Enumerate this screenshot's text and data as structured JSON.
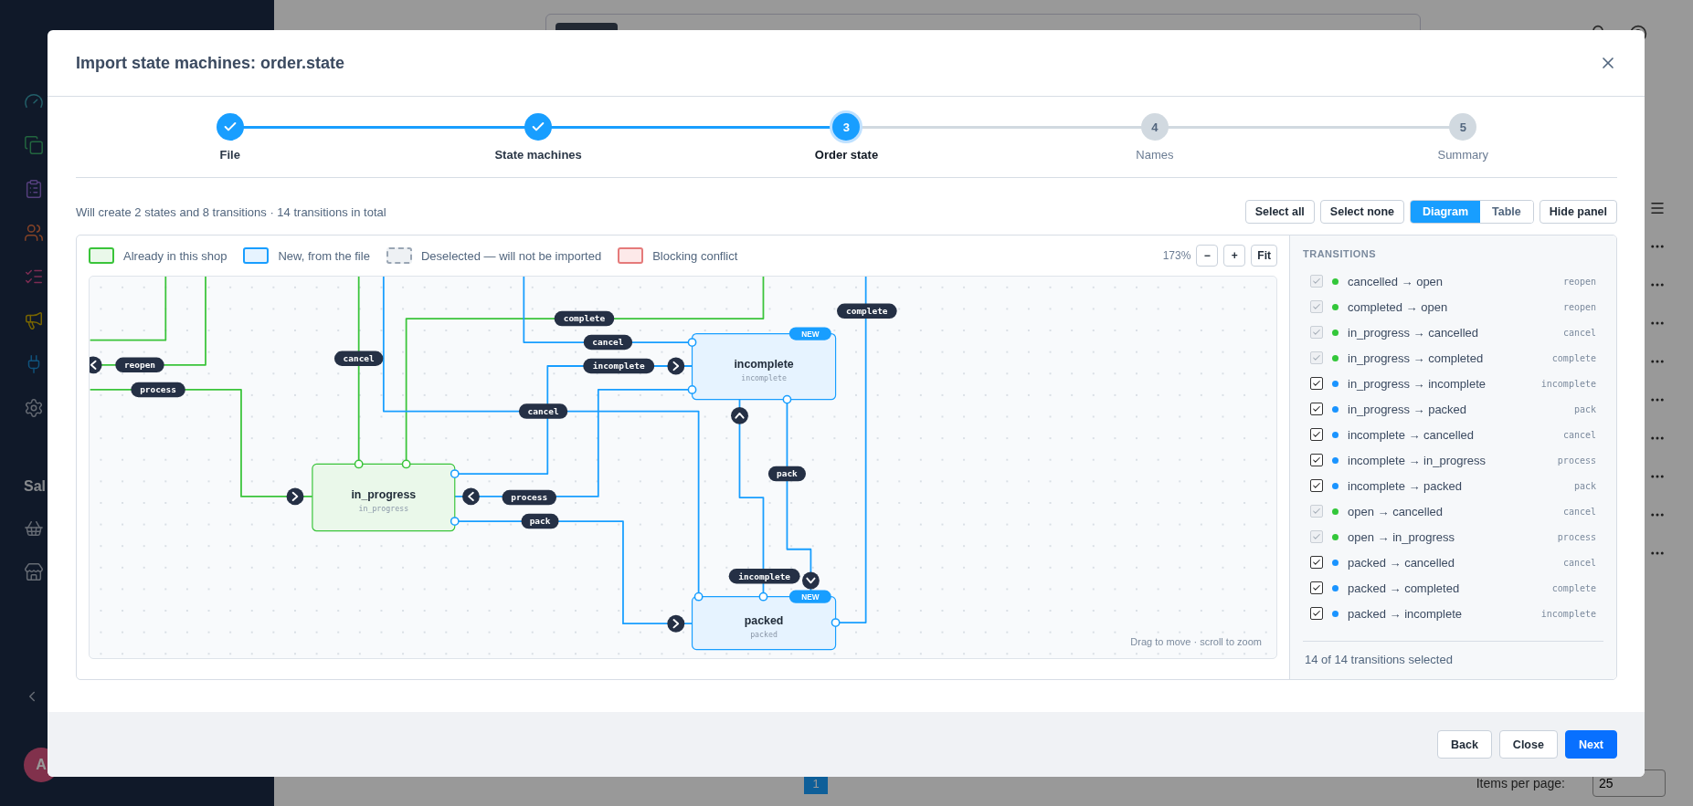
{
  "background": {
    "sidebar_section": "Sal",
    "user_initial": "A",
    "pagination": {
      "page": "1"
    },
    "items_per_page_label": "Items per page:",
    "items_per_page": "25"
  },
  "modal": {
    "title": "Import state machines: order.state",
    "steps": [
      {
        "label": "File",
        "completed": true,
        "selected": false
      },
      {
        "label": "State machines",
        "completed": true,
        "selected": false
      },
      {
        "number": "3",
        "label": "Order state",
        "completed": false,
        "selected": true
      },
      {
        "number": "4",
        "label": "Names",
        "completed": false,
        "selected": false
      },
      {
        "number": "5",
        "label": "Summary",
        "completed": false,
        "selected": false
      }
    ],
    "summary": "Will create 2 states and 8 transitions · 14 transitions in total",
    "actions": {
      "select_all": "Select all",
      "select_none": "Select none",
      "views": [
        {
          "label": "Diagram",
          "selected": true
        },
        {
          "label": "Table",
          "selected": false
        }
      ],
      "hide_panel": "Hide panel"
    },
    "legend": [
      {
        "label": "Already in this shop",
        "kind": "existing"
      },
      {
        "label": "New, from the file",
        "kind": "new"
      },
      {
        "label": "Deselected — will not be imported",
        "kind": "deselected"
      },
      {
        "label": "Blocking conflict",
        "kind": "conflict"
      }
    ],
    "zoom": {
      "level": "173%",
      "zoom_out": "−",
      "zoom_in": "+",
      "fit": "Fit"
    },
    "diagram": {
      "nodes": [
        {
          "title": "in_progress",
          "subtitle": "in_progress",
          "kind": "existing"
        },
        {
          "title": "incomplete",
          "subtitle": "incomplete",
          "kind": "new",
          "badge": "NEW"
        },
        {
          "title": "packed",
          "subtitle": "packed",
          "kind": "new",
          "badge": "NEW"
        }
      ],
      "edges": [
        {
          "label": "cancel",
          "kind": "existing"
        },
        {
          "label": "complete",
          "kind": "existing"
        },
        {
          "kind": "existing"
        },
        {
          "label": "reopen",
          "kind": "existing"
        },
        {
          "label": "process",
          "kind": "existing"
        },
        {
          "label": "cancel",
          "kind": "new"
        },
        {
          "label": "cancel",
          "kind": "new"
        },
        {
          "label": "incomplete",
          "kind": "new"
        },
        {
          "label": "process",
          "kind": "new"
        },
        {
          "label": "pack",
          "kind": "new"
        },
        {
          "label": "incomplete",
          "kind": "new"
        },
        {
          "label": "pack",
          "kind": "new"
        },
        {
          "label": "complete",
          "kind": "new"
        }
      ],
      "hint": "Drag to move · scroll to zoom"
    },
    "transitions": {
      "title": "TRANSITIONS",
      "items": [
        {
          "name": "cancelled → open",
          "action": "reopen",
          "checked": true,
          "disabled": true,
          "color": "#33c73a"
        },
        {
          "name": "completed → open",
          "action": "reopen",
          "checked": true,
          "disabled": true,
          "color": "#33c73a"
        },
        {
          "name": "in_progress → cancelled",
          "action": "cancel",
          "checked": true,
          "disabled": true,
          "color": "#33c73a"
        },
        {
          "name": "in_progress → completed",
          "action": "complete",
          "checked": true,
          "disabled": true,
          "color": "#33c73a"
        },
        {
          "name": "in_progress → incomplete",
          "action": "incomplete",
          "checked": true,
          "disabled": false,
          "color": "#1a94ff"
        },
        {
          "name": "in_progress → packed",
          "action": "pack",
          "checked": true,
          "disabled": false,
          "color": "#1a94ff"
        },
        {
          "name": "incomplete → cancelled",
          "action": "cancel",
          "checked": true,
          "disabled": false,
          "color": "#1a94ff"
        },
        {
          "name": "incomplete → in_progress",
          "action": "process",
          "checked": true,
          "disabled": false,
          "color": "#1a94ff"
        },
        {
          "name": "incomplete → packed",
          "action": "pack",
          "checked": true,
          "disabled": false,
          "color": "#1a94ff"
        },
        {
          "name": "open → cancelled",
          "action": "cancel",
          "checked": true,
          "disabled": true,
          "color": "#33c73a"
        },
        {
          "name": "open → in_progress",
          "action": "process",
          "checked": true,
          "disabled": true,
          "color": "#33c73a"
        },
        {
          "name": "packed → cancelled",
          "action": "cancel",
          "checked": true,
          "disabled": false,
          "color": "#1a94ff"
        },
        {
          "name": "packed → completed",
          "action": "complete",
          "checked": true,
          "disabled": false,
          "color": "#1a94ff"
        },
        {
          "name": "packed → incomplete",
          "action": "incomplete",
          "checked": true,
          "disabled": false,
          "color": "#1a94ff"
        }
      ],
      "footer": "14 of 14 transitions selected"
    },
    "buttons": {
      "back": "Back",
      "close": "Close",
      "next": "Next"
    }
  }
}
